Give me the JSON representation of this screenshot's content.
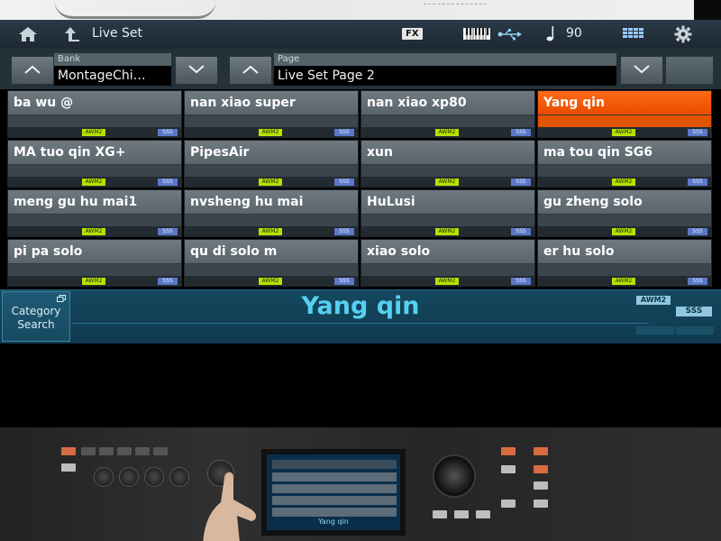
{
  "header": {
    "title": "Live Set",
    "fx_label": "FX",
    "tempo": "90"
  },
  "bank": {
    "label": "Bank",
    "value": "MontageChi…"
  },
  "page": {
    "label": "Page",
    "value": "Live Set Page 2"
  },
  "badges": {
    "awm": "AWM2",
    "sss": "SSS"
  },
  "slots": [
    {
      "name": "ba wu @",
      "selected": false
    },
    {
      "name": "nan xiao super",
      "selected": false
    },
    {
      "name": "nan xiao xp80",
      "selected": false
    },
    {
      "name": "Yang qin",
      "selected": true
    },
    {
      "name": "MA tuo qin XG+",
      "selected": false
    },
    {
      "name": "PipesAir",
      "selected": false
    },
    {
      "name": "xun",
      "selected": false
    },
    {
      "name": "ma tou qin SG6",
      "selected": false
    },
    {
      "name": "meng gu hu mai1",
      "selected": false
    },
    {
      "name": "nvsheng hu mai",
      "selected": false
    },
    {
      "name": "HuLusi",
      "selected": false
    },
    {
      "name": "gu zheng solo",
      "selected": false
    },
    {
      "name": "pi pa solo",
      "selected": false
    },
    {
      "name": "qu di solo m",
      "selected": false
    },
    {
      "name": "xiao solo",
      "selected": false
    },
    {
      "name": "er hu solo",
      "selected": false
    }
  ],
  "info": {
    "category_search": "Category Search",
    "current_performance": "Yang qin",
    "awm2": "AWM2",
    "sss": "SSS"
  },
  "hardware_screen": {
    "caption": "Yang qin"
  },
  "colors": {
    "selected_slot": "#ff5a00",
    "performance_name": "#56d0f2",
    "info_bar": "#0f3a4f",
    "awm_badge": "#b8e000",
    "sss_badge": "#5b78c8"
  }
}
